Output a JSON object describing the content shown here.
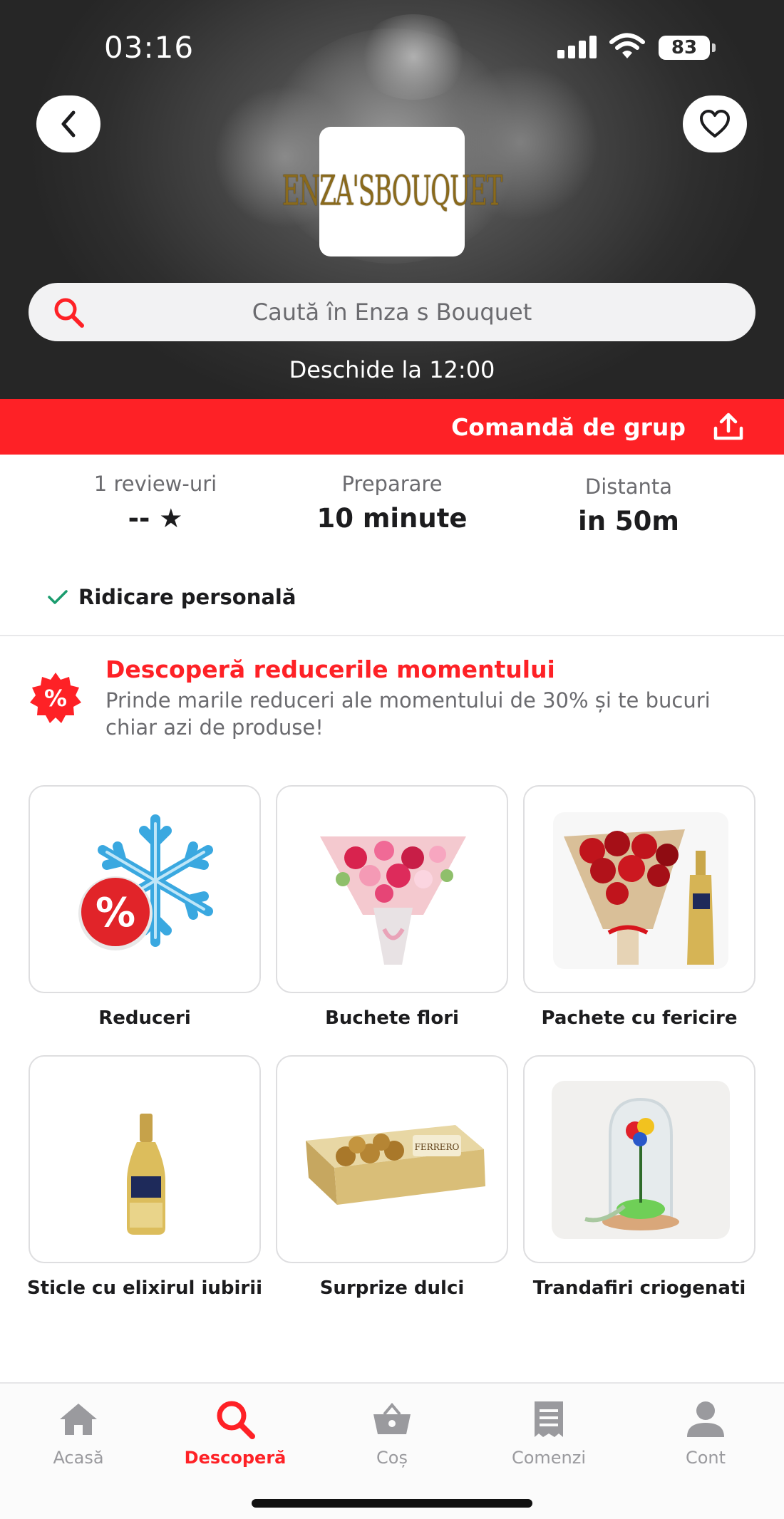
{
  "status_bar": {
    "time": "03:16",
    "battery": "83"
  },
  "store": {
    "logo_text": "ENZA'SBOUQUET",
    "search_placeholder": "Caută în Enza s Bouquet",
    "open_hours": "Deschide la 12:00"
  },
  "group_order": {
    "label": "Comandă de grup"
  },
  "stats": {
    "reviews": {
      "label": "1 review-uri",
      "value": "-- ★"
    },
    "preparation": {
      "label": "Preparare",
      "value": "10 minute"
    },
    "distance": {
      "label": "Distanta",
      "value": "in 50m"
    }
  },
  "pickup": {
    "label": "Ridicare personală"
  },
  "promo": {
    "badge": "%",
    "title": "Descoperă reducerile momentului",
    "text": "Prinde marile reduceri ale momentului de 30% și te bucuri chiar azi de produse!"
  },
  "categories": [
    {
      "label": "Reduceri",
      "icon": "snowflake-discount-icon"
    },
    {
      "label": "Buchete flori",
      "icon": "bouquet-image"
    },
    {
      "label": "Pachete cu fericire",
      "icon": "roses-champagne-image"
    },
    {
      "label": "Sticle cu elixirul iubirii",
      "icon": "bottle-image"
    },
    {
      "label": "Surprize dulci",
      "icon": "chocolate-box-image"
    },
    {
      "label": "Trandafiri criogenati",
      "icon": "rose-dome-image"
    }
  ],
  "bottom_nav": [
    {
      "label": "Acasă",
      "icon": "home-icon",
      "active": false
    },
    {
      "label": "Descoperă",
      "icon": "search-icon",
      "active": true
    },
    {
      "label": "Coș",
      "icon": "basket-icon",
      "active": false
    },
    {
      "label": "Comenzi",
      "icon": "receipt-icon",
      "active": false
    },
    {
      "label": "Cont",
      "icon": "user-icon",
      "active": false
    }
  ],
  "colors": {
    "accent": "#fe2126",
    "text": "#1c1c1e",
    "muted": "#6b6b6f",
    "nav_inactive": "#9a9a9e",
    "check": "#1a9c6e"
  }
}
